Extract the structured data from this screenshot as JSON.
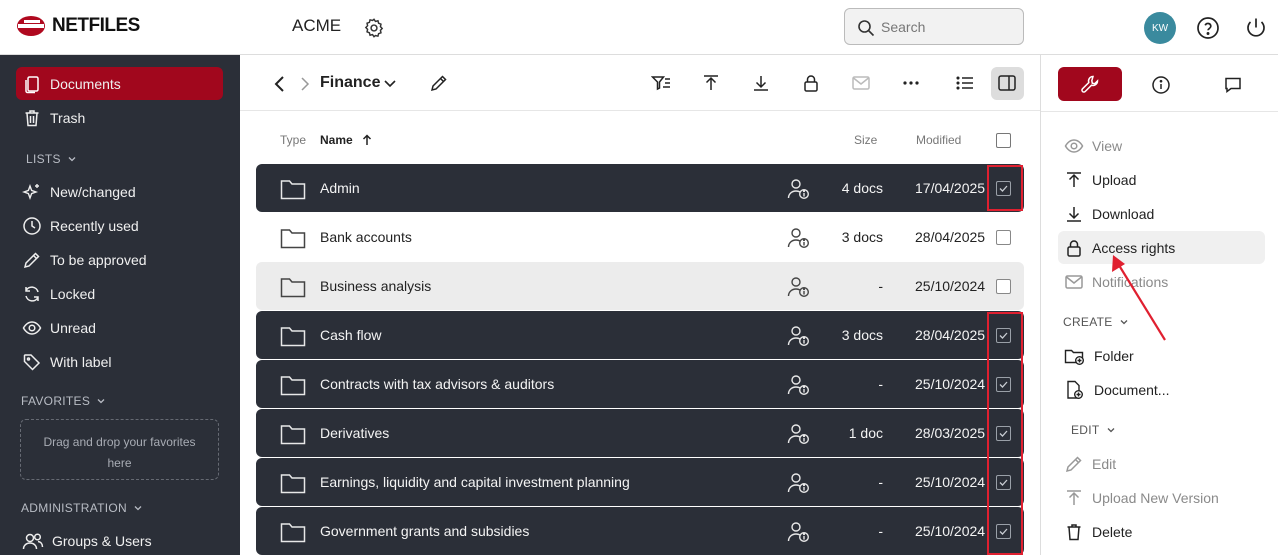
{
  "app": {
    "logo_text": "NETFILES",
    "org_name": "ACME",
    "search_placeholder": "Search",
    "avatar_initials": "KW"
  },
  "sidebar": {
    "items": [
      {
        "label": "Documents",
        "icon": "documents-icon",
        "active": true
      },
      {
        "label": "Trash",
        "icon": "trash-icon"
      }
    ],
    "lists_header": "LISTS",
    "lists": [
      {
        "label": "New/changed",
        "icon": "sparkle-icon"
      },
      {
        "label": "Recently used",
        "icon": "clock-icon"
      },
      {
        "label": "To be approved",
        "icon": "pencil-icon"
      },
      {
        "label": "Locked",
        "icon": "refresh-lock-icon"
      },
      {
        "label": "Unread",
        "icon": "eye-icon"
      },
      {
        "label": "With label",
        "icon": "tag-icon"
      }
    ],
    "favorites_header": "FAVORITES",
    "favorites_dropzone": "Drag and drop your favorites here",
    "admin_header": "ADMINISTRATION",
    "admin_items": [
      {
        "label": "Groups & Users",
        "icon": "users-icon"
      }
    ]
  },
  "main": {
    "folder_name": "Finance",
    "columns": {
      "type": "Type",
      "name": "Name",
      "size": "Size",
      "modified": "Modified"
    },
    "rows": [
      {
        "name": "Admin",
        "size": "4 docs",
        "modified": "17/04/2025",
        "selected": true
      },
      {
        "name": "Bank accounts",
        "size": "3 docs",
        "modified": "28/04/2025",
        "selected": false
      },
      {
        "name": "Business analysis",
        "size": "-",
        "modified": "25/10/2024",
        "selected": false,
        "hover": true
      },
      {
        "name": "Cash flow",
        "size": "3 docs",
        "modified": "28/04/2025",
        "selected": true
      },
      {
        "name": "Contracts with tax advisors & auditors",
        "size": "-",
        "modified": "25/10/2024",
        "selected": true
      },
      {
        "name": "Derivatives",
        "size": "1 doc",
        "modified": "28/03/2025",
        "selected": true
      },
      {
        "name": "Earnings, liquidity and capital investment planning",
        "size": "-",
        "modified": "25/10/2024",
        "selected": true
      },
      {
        "name": "Government grants and subsidies",
        "size": "-",
        "modified": "25/10/2024",
        "selected": true
      }
    ]
  },
  "right_panel": {
    "actions": [
      {
        "label": "View",
        "icon": "eye-icon",
        "disabled": true
      },
      {
        "label": "Upload",
        "icon": "upload-icon"
      },
      {
        "label": "Download",
        "icon": "download-icon"
      },
      {
        "label": "Access rights",
        "icon": "lock-icon",
        "hover": true
      },
      {
        "label": "Notifications",
        "icon": "mail-icon",
        "disabled": true
      }
    ],
    "create_header": "CREATE",
    "create": [
      {
        "label": "Folder",
        "icon": "new-folder-icon"
      },
      {
        "label": "Document...",
        "icon": "new-document-icon"
      }
    ],
    "edit_header": "EDIT",
    "edit": [
      {
        "label": "Edit",
        "icon": "pencil-icon",
        "disabled": true
      },
      {
        "label": "Upload New Version",
        "icon": "upload-icon",
        "disabled": true
      },
      {
        "label": "Delete",
        "icon": "trash-icon"
      }
    ]
  },
  "colors": {
    "brand": "#a1071d",
    "sidebar_bg": "#2b2f38",
    "highlight": "#e02030"
  }
}
